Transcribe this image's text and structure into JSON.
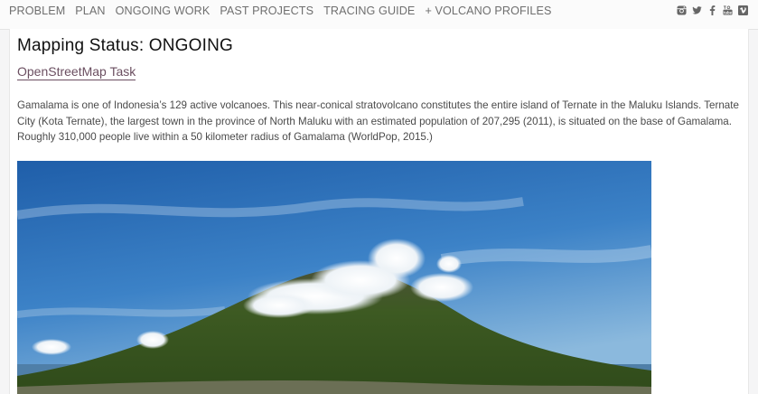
{
  "nav": {
    "items": [
      {
        "label": "PROBLEM"
      },
      {
        "label": "PLAN"
      },
      {
        "label": "ONGOING WORK"
      },
      {
        "label": "PAST PROJECTS"
      },
      {
        "label": "TRACING GUIDE"
      },
      {
        "label": "+ VOLCANO PROFILES"
      }
    ],
    "social_icons": [
      "instagram-icon",
      "twitter-icon",
      "facebook-icon",
      "youtube-icon",
      "vimeo-icon"
    ]
  },
  "main": {
    "title": "Mapping Status: ONGOING",
    "task_link": "OpenStreetMap Task",
    "description": "Gamalama is one of Indonesia’s 129 active volcanoes. This near-conical stratovolcano constitutes the entire island of Ternate in the Maluku Islands. Ternate City (Kota Ternate), the largest town in the province of North Maluku with an estimated population of 207,295 (2011), is situated on the base of Gamalama. Roughly 310,000 people live within a 50 kilometer radius of Gamalama (WorldPop, 2015.)"
  },
  "colors": {
    "nav_text": "#6f6f6f",
    "link": "#6b4f61",
    "sky": "#2f6fb8",
    "mountain": "#3f5a24"
  }
}
